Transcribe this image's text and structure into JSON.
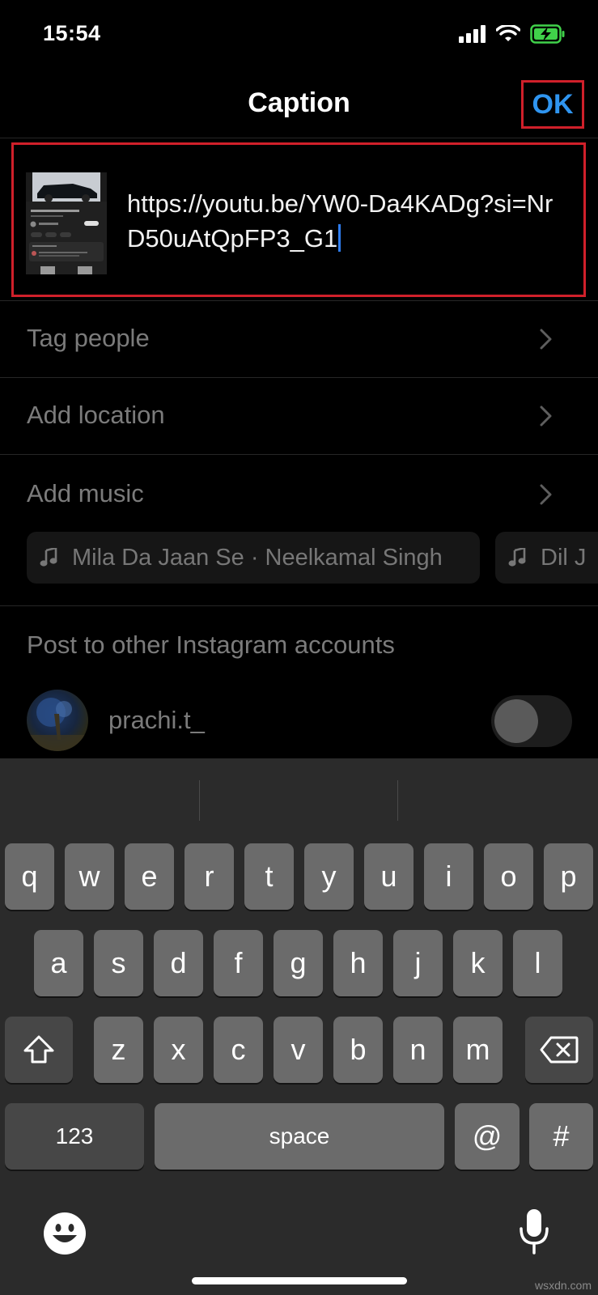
{
  "status": {
    "time": "15:54"
  },
  "header": {
    "title": "Caption",
    "ok_label": "OK"
  },
  "caption": {
    "text": "https://youtu.be/YW0-Da4KADg?si=NrD50uAtQpFP3_G1"
  },
  "rows": {
    "tag_people": "Tag people",
    "add_location": "Add location",
    "add_music": "Add music"
  },
  "music_chips": [
    {
      "label": "Mila Da Jaan Se · Neelkamal Singh"
    },
    {
      "label": "Dil J"
    }
  ],
  "other_accounts": {
    "heading": "Post to other Instagram accounts",
    "account_name": "prachi.t_",
    "toggle_on": false
  },
  "keyboard": {
    "row1": [
      "q",
      "w",
      "e",
      "r",
      "t",
      "y",
      "u",
      "i",
      "o",
      "p"
    ],
    "row2": [
      "a",
      "s",
      "d",
      "f",
      "g",
      "h",
      "j",
      "k",
      "l"
    ],
    "row3": [
      "z",
      "x",
      "c",
      "v",
      "b",
      "n",
      "m"
    ],
    "numbers_key": "123",
    "space_key": "space",
    "at_key": "@",
    "hash_key": "#"
  },
  "watermark": "wsxdn.com",
  "colors": {
    "accent": "#2f95f0",
    "highlight_border": "#d0202a"
  }
}
